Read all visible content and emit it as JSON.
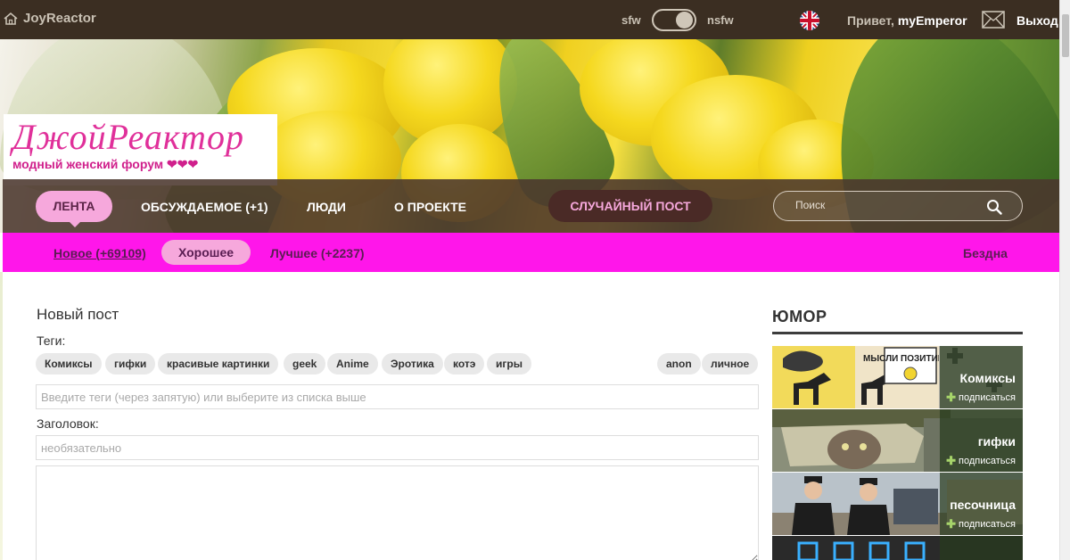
{
  "topbar": {
    "brand": "JoyReactor",
    "sfw_label": "sfw",
    "nsfw_label": "nsfw",
    "greeting": "Привет,",
    "username": "myEmperor",
    "logout": "Выход"
  },
  "logo": {
    "title": "ДжойРеактор",
    "subtitle": "модный женский форум ❤❤❤"
  },
  "nav": {
    "items": [
      "ЛЕНТА",
      "ОБСУЖДАЕМОЕ (+1)",
      "ЛЮДИ",
      "О ПРОЕКТЕ"
    ],
    "random": "СЛУЧАЙНЫЙ ПОСТ",
    "search_placeholder": "Поиск"
  },
  "subnav": {
    "new": "Новое (+69109)",
    "good": "Хорошее",
    "best": "Лучшее (+2237)",
    "abyss": "Бездна"
  },
  "form": {
    "title": "Новый пост",
    "tags_label": "Теги:",
    "tags": [
      "Комиксы",
      "гифки",
      "красивые картинки",
      "geek",
      "Anime",
      "Эротика",
      "котэ",
      "игры"
    ],
    "tags_right": [
      "anon",
      "личное"
    ],
    "tags_placeholder": "Введите теги (через запятую) или выберите из списка выше",
    "heading_label": "Заголовок:",
    "heading_placeholder": "необязательно"
  },
  "sidebar": {
    "title": "ЮМОР",
    "subscribe": "подписаться",
    "tiles": [
      {
        "name": "Комиксы",
        "thumb_text": "МЫСЛИ ПОЗИТИВНО"
      },
      {
        "name": "гифки"
      },
      {
        "name": "песочница"
      }
    ]
  }
}
